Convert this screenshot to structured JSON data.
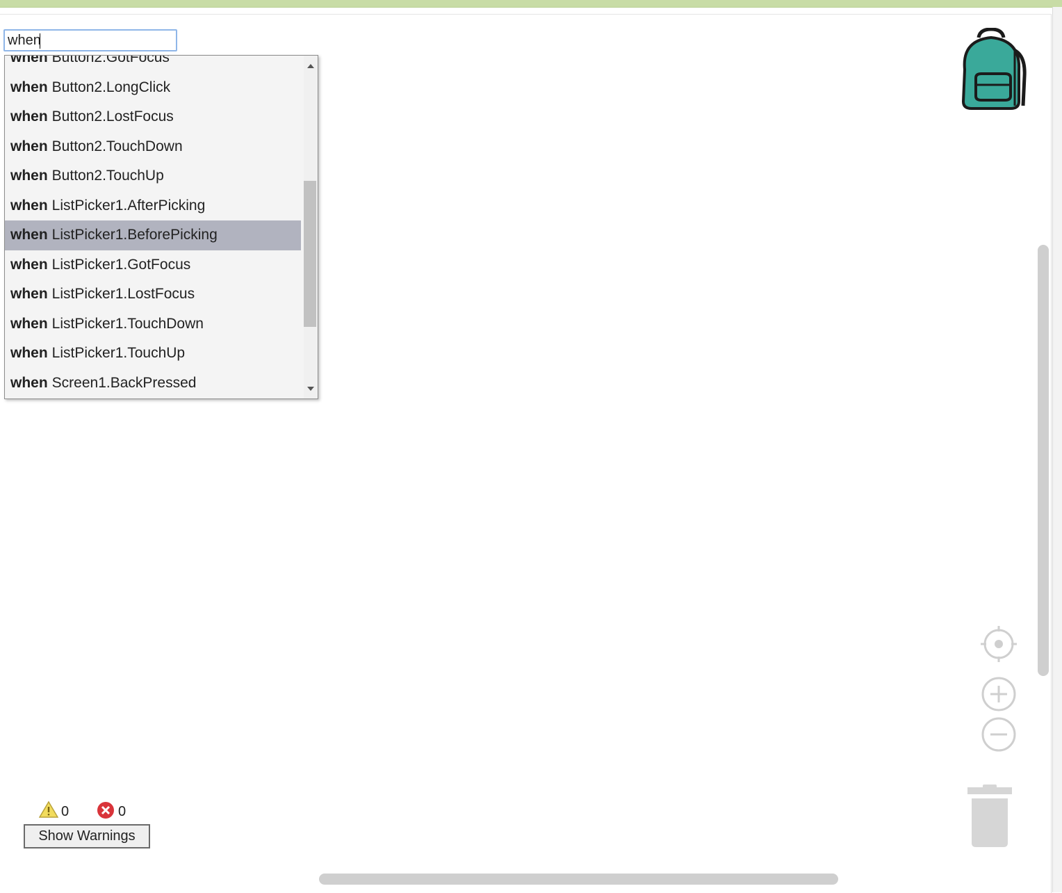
{
  "search": {
    "value": "when"
  },
  "dropdown": {
    "items": [
      {
        "keyword": "when",
        "event": "Button2.GotFocus",
        "selected": false
      },
      {
        "keyword": "when",
        "event": "Button2.LongClick",
        "selected": false
      },
      {
        "keyword": "when",
        "event": "Button2.LostFocus",
        "selected": false
      },
      {
        "keyword": "when",
        "event": "Button2.TouchDown",
        "selected": false
      },
      {
        "keyword": "when",
        "event": "Button2.TouchUp",
        "selected": false
      },
      {
        "keyword": "when",
        "event": "ListPicker1.AfterPicking",
        "selected": false
      },
      {
        "keyword": "when",
        "event": "ListPicker1.BeforePicking",
        "selected": true
      },
      {
        "keyword": "when",
        "event": "ListPicker1.GotFocus",
        "selected": false
      },
      {
        "keyword": "when",
        "event": "ListPicker1.LostFocus",
        "selected": false
      },
      {
        "keyword": "when",
        "event": "ListPicker1.TouchDown",
        "selected": false
      },
      {
        "keyword": "when",
        "event": "ListPicker1.TouchUp",
        "selected": false
      },
      {
        "keyword": "when",
        "event": "Screen1.BackPressed",
        "selected": false
      }
    ]
  },
  "warnings": {
    "warning_count": "0",
    "error_count": "0",
    "show_warnings_label": "Show Warnings"
  },
  "icons": {
    "backpack": "backpack-icon",
    "recenter": "recenter-icon",
    "zoom_in": "zoom-in-icon",
    "zoom_out": "zoom-out-icon",
    "trash": "trash-icon",
    "warning": "warning-icon",
    "error": "error-icon"
  },
  "colors": {
    "backpack": "#3aa99a",
    "selected_item": "#b1b3bf",
    "top_bar": "#c8dca6",
    "error": "#d9343a",
    "warning": "#f2dc5d"
  }
}
